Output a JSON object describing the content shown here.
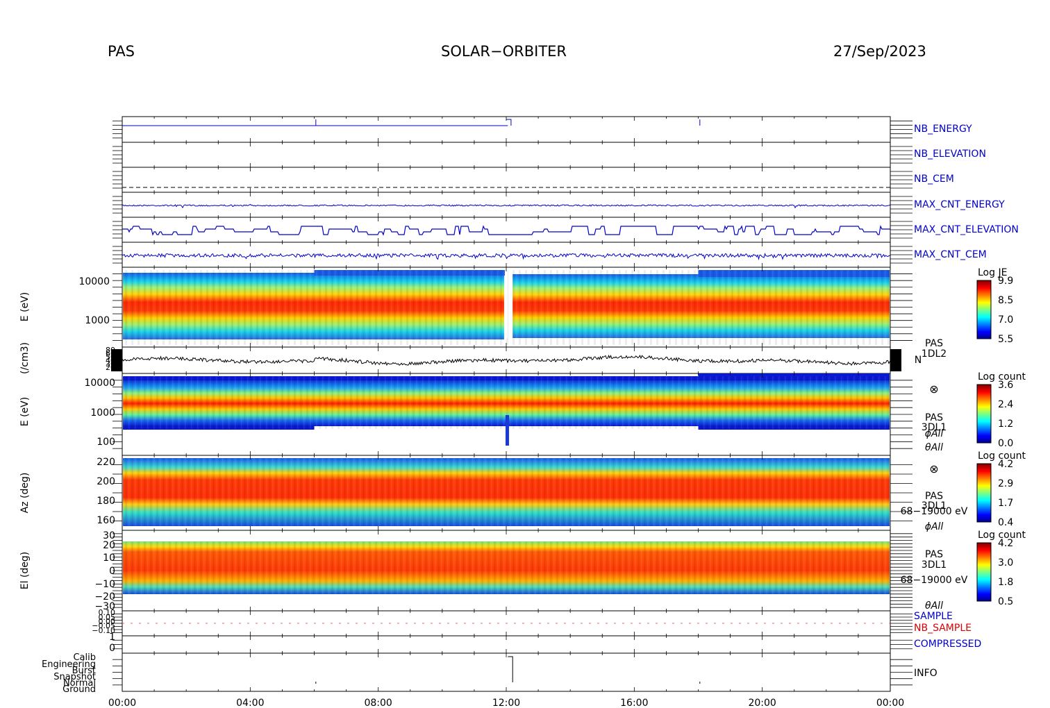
{
  "header": {
    "instrument": "PAS",
    "mission": "SOLAR−ORBITER",
    "date": "27/Sep/2023"
  },
  "colors": {
    "label_blue": "#0000cc",
    "label_red": "#dd0000",
    "trace_blue": "#0000cc",
    "trace_black": "#000000"
  },
  "chart_data": {
    "type": "heatmap",
    "x_axis": {
      "ticks": [
        "00:00",
        "04:00",
        "08:00",
        "12:00",
        "16:00",
        "20:00",
        "00:00"
      ],
      "range_hours": [
        0,
        24
      ]
    },
    "panels": [
      {
        "id": "nb_energy",
        "label": "NB_ENERGY",
        "label_color": "blue"
      },
      {
        "id": "nb_elevation",
        "label": "NB_ELEVATION",
        "label_color": "blue"
      },
      {
        "id": "nb_cem",
        "label": "NB_CEM",
        "label_color": "blue"
      },
      {
        "id": "max_cnt_energy",
        "label": "MAX_CNT_ENERGY",
        "label_color": "blue"
      },
      {
        "id": "max_cnt_elevation",
        "label": "MAX_CNT_ELEVATION",
        "label_color": "blue"
      },
      {
        "id": "max_cnt_cem",
        "label": "MAX_CNT_CEM",
        "label_color": "blue"
      },
      {
        "id": "energy_je",
        "ylabel": "E (eV)",
        "yticks": [
          "10000",
          "1000"
        ],
        "colorbar": {
          "title": "Log JE",
          "ticks": [
            "9.9",
            "8.5",
            "7.0",
            "5.5"
          ]
        }
      },
      {
        "id": "density",
        "ylabel": "(/cm3)",
        "yticks": [
          "80",
          "60",
          "50",
          "40",
          "30",
          "20"
        ],
        "right_labels": [
          "PAS",
          "1DL2",
          "N"
        ],
        "yrange": [
          20,
          80
        ]
      },
      {
        "id": "energy_counts",
        "ylabel": "E (eV)",
        "yticks": [
          "10000",
          "1000",
          "100"
        ],
        "right_labels": [
          "⊗",
          "PAS",
          "3DL1",
          "ϕAll",
          "θAll"
        ],
        "colorbar": {
          "title": "Log count",
          "ticks": [
            "3.6",
            "2.4",
            "1.2",
            "0.0"
          ]
        }
      },
      {
        "id": "azimuth",
        "ylabel": "Az (deg)",
        "yticks": [
          "220",
          "200",
          "180",
          "160"
        ],
        "right_labels": [
          "⊗",
          "PAS",
          "3DL1",
          "68−19000 eV",
          "ϕAll"
        ],
        "colorbar": {
          "title": "Log count",
          "ticks": [
            "4.2",
            "2.9",
            "1.7",
            "0.4"
          ]
        }
      },
      {
        "id": "elevation",
        "ylabel": "El (deg)",
        "yticks": [
          "30",
          "20",
          "10",
          "0",
          "−10",
          "−20",
          "−30"
        ],
        "right_labels": [
          "PAS",
          "3DL1",
          "68−19000 eV",
          "θAll"
        ],
        "colorbar": {
          "title": "Log count",
          "ticks": [
            "4.2",
            "3.0",
            "1.8",
            "0.5"
          ]
        }
      },
      {
        "id": "sample",
        "labels": [
          "SAMPLE",
          "NB_SAMPLE"
        ],
        "yticks": [
          "0.10",
          "0.05",
          "0.00",
          "−0.05",
          "−0.10"
        ]
      },
      {
        "id": "compressed",
        "label": "COMPRESSED",
        "yticks": [
          "1",
          "0"
        ]
      },
      {
        "id": "info",
        "label": "INFO",
        "yticks": [
          "Calib",
          "Engineering",
          "Burst",
          "Snapshot",
          "Normal",
          "Ground"
        ]
      }
    ]
  }
}
